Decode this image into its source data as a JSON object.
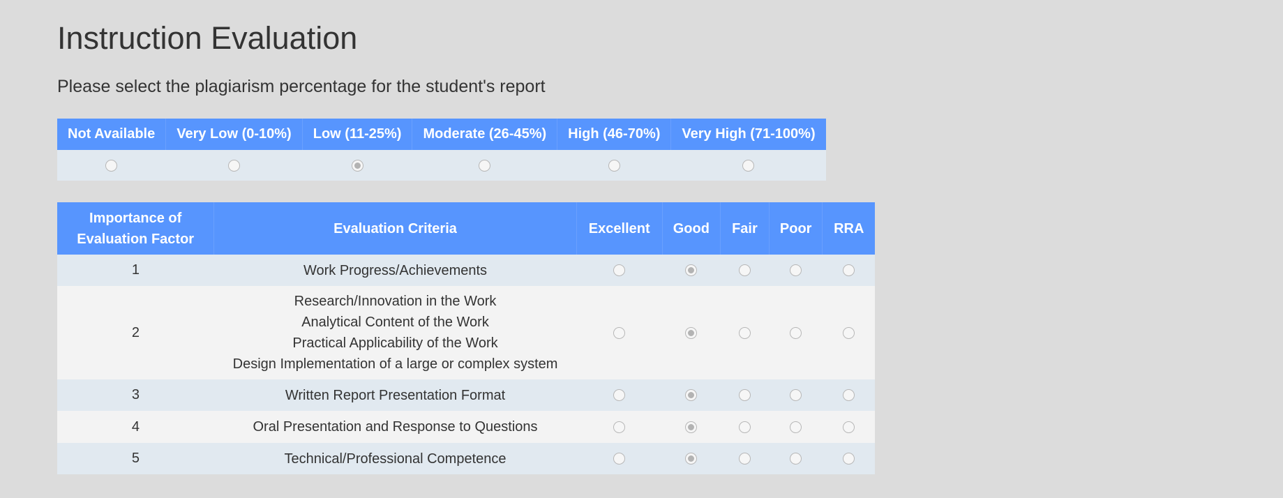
{
  "page": {
    "title": "Instruction Evaluation",
    "subtitle": "Please select the plagiarism percentage for the student's report"
  },
  "plagiarism": {
    "options": [
      "Not Available",
      "Very Low (0-10%)",
      "Low (11-25%)",
      "Moderate (26-45%)",
      "High (46-70%)",
      "Very High (71-100%)"
    ],
    "selected": "Low (11-25%)"
  },
  "evaluation": {
    "headers": {
      "importance_line1": "Importance of",
      "importance_line2": "Evaluation Factor",
      "criteria": "Evaluation Criteria",
      "ratings": [
        "Excellent",
        "Good",
        "Fair",
        "Poor",
        "RRA"
      ]
    },
    "rows": [
      {
        "importance": "1",
        "criteria": [
          "Work Progress/Achievements"
        ],
        "selected": "Good"
      },
      {
        "importance": "2",
        "criteria": [
          "Research/Innovation in the Work",
          "Analytical Content of the Work",
          "Practical Applicability of the Work",
          "Design Implementation of a large or complex system"
        ],
        "selected": "Good"
      },
      {
        "importance": "3",
        "criteria": [
          "Written Report Presentation Format"
        ],
        "selected": "Good"
      },
      {
        "importance": "4",
        "criteria": [
          "Oral Presentation and Response to Questions"
        ],
        "selected": "Good"
      },
      {
        "importance": "5",
        "criteria": [
          "Technical/Professional Competence"
        ],
        "selected": "Good"
      }
    ]
  },
  "colors": {
    "header_bg": "#5795fe",
    "row_odd": "#e1e9f0",
    "row_even": "#f3f3f3",
    "page_bg": "#dcdcdc"
  }
}
